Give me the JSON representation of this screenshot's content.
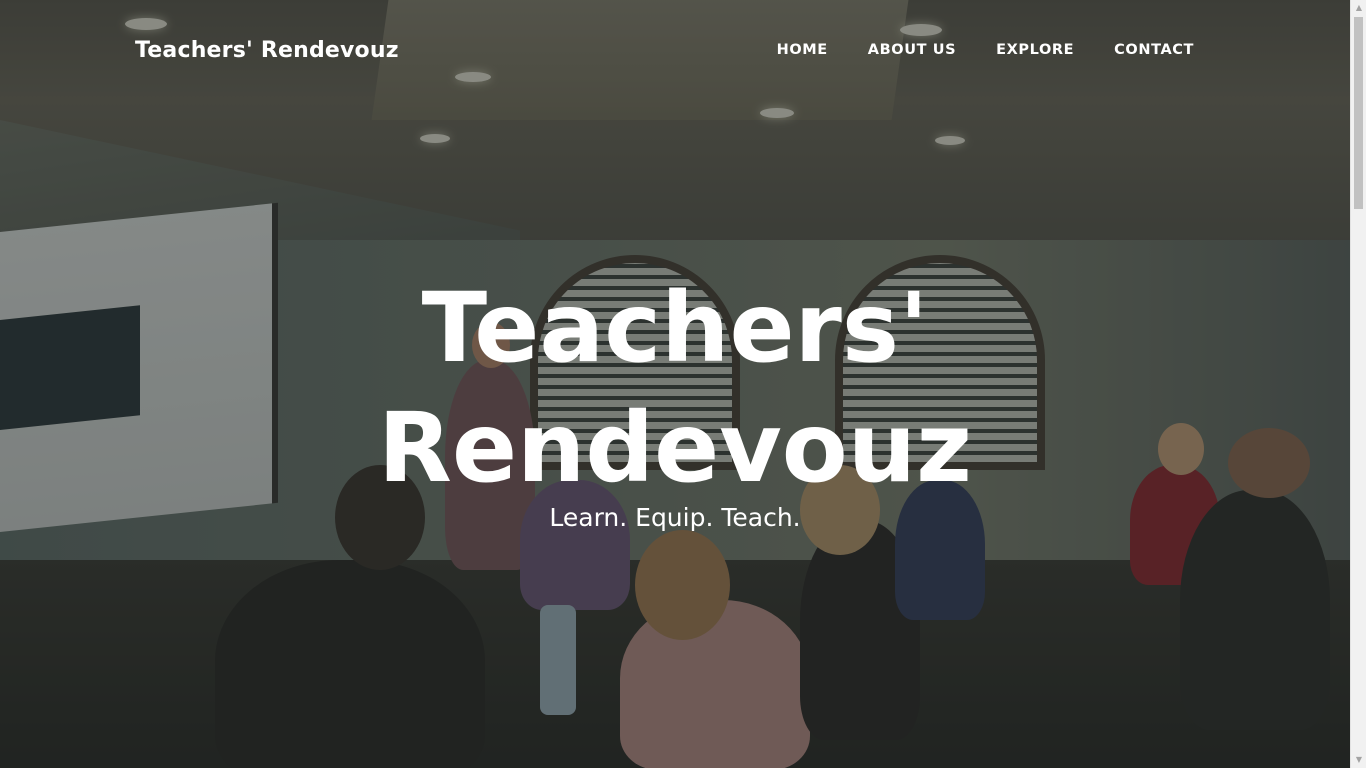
{
  "nav": {
    "brand": "Teachers' Rendevouz",
    "items": [
      {
        "label": "HOME"
      },
      {
        "label": "ABOUT US"
      },
      {
        "label": "EXPLORE"
      },
      {
        "label": "CONTACT"
      }
    ]
  },
  "hero": {
    "title_line1": "Teachers'",
    "title_line2": "Rendevouz",
    "subtitle": "Learn. Equip. Teach.",
    "background_image": "classroom-presentation-photo"
  },
  "colors": {
    "text": "#ffffff",
    "overlay": "#161a1a"
  }
}
